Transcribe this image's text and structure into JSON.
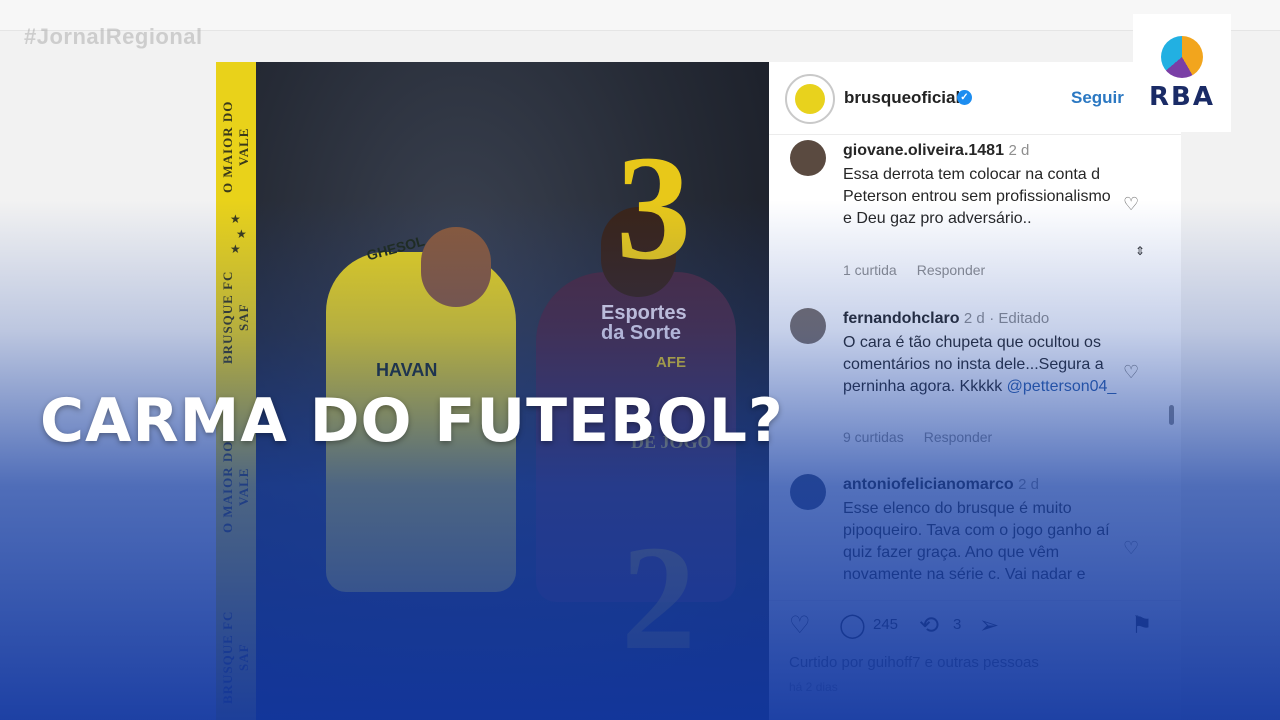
{
  "watermark": {
    "hashtag": "#JornalRegional"
  },
  "logo": {
    "text": "RBA"
  },
  "headline": "CARMA DO FUTEBOL?",
  "post_image": {
    "stripe_top": "O MAIOR DO VALE",
    "stripe_mid": "BRUSQUE FC SAF",
    "stripe_low": "O MAIOR DO VALE",
    "stripe_bottom": "BRUSQUE FC SAF",
    "score_home": "3",
    "score_away": "2",
    "jersey_yellow_1": "GHESOL",
    "jersey_yellow_2": "HAVAN",
    "jersey_purple_1": "Esportes",
    "jersey_purple_2": "da Sorte",
    "jersey_purple_3": "AFE",
    "overlay_text": "DE JOGO"
  },
  "instagram": {
    "account": "brusqueoficial",
    "verified_mark": "✓",
    "follow_label": "Seguir",
    "comments": [
      {
        "user": "giovane.oliveira.1481",
        "time": "2 d",
        "edited": "",
        "text": "Essa derrota tem colocar na conta d Peterson entrou sem profissionalismo e Deu gaz pro adversário..",
        "likes": "1 curtida",
        "reply": "Responder"
      },
      {
        "user": "fernandohclaro",
        "time": "2 d",
        "edited": "· Editado",
        "text": "O cara é tão chupeta que ocultou os comentários no insta dele...Segura a perninha agora. Kkkkk",
        "mention": "@petterson04_",
        "likes": "9 curtidas",
        "reply": "Responder"
      },
      {
        "user": "antoniofelicianomarco",
        "time": "2 d",
        "edited": "",
        "text": "Esse elenco do brusque é muito pipoqueiro. Tava com o jogo ganho aí quiz fazer graça. Ano que vêm novamente na série c. Vai nadar e",
        "likes": "",
        "reply": ""
      }
    ],
    "actions": {
      "comment_count": "245",
      "repost_count": "3"
    },
    "liked_by": "Curtido por guihoff7 e outras pessoas",
    "posted_ago": "há 2 dias"
  }
}
